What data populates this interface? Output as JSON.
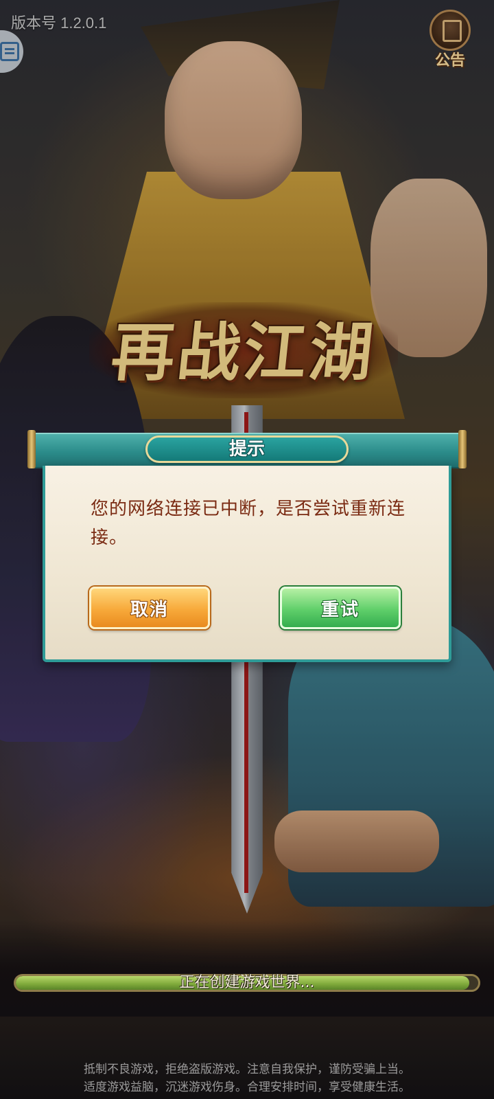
{
  "version": {
    "text": "版本号 1.2.0.1"
  },
  "floating_badge": {
    "icon": "floating-menu-icon"
  },
  "announcement": {
    "label": "公告",
    "icon": "announcement-scroll-icon"
  },
  "logo": {
    "text": "再战江湖"
  },
  "dialog": {
    "title": "提示",
    "message": "您的网络连接已中断，是否尝试重新连接。",
    "cancel_label": "取消",
    "retry_label": "重试"
  },
  "loading": {
    "text": "正在创建游戏世界...",
    "progress": 0.98
  },
  "health_notice": {
    "line1": "抵制不良游戏，拒绝盗版游戏。注意自我保护，谨防受骗上当。",
    "line2": "适度游戏益脑，沉迷游戏伤身。合理安排时间，享受健康生活。"
  },
  "colors": {
    "dialog_accent": "#2f9c98",
    "message_text": "#7a2a12",
    "cancel_button": "#f7a93a",
    "retry_button": "#5fcf6a",
    "progress_fill": "#7ea83a"
  }
}
